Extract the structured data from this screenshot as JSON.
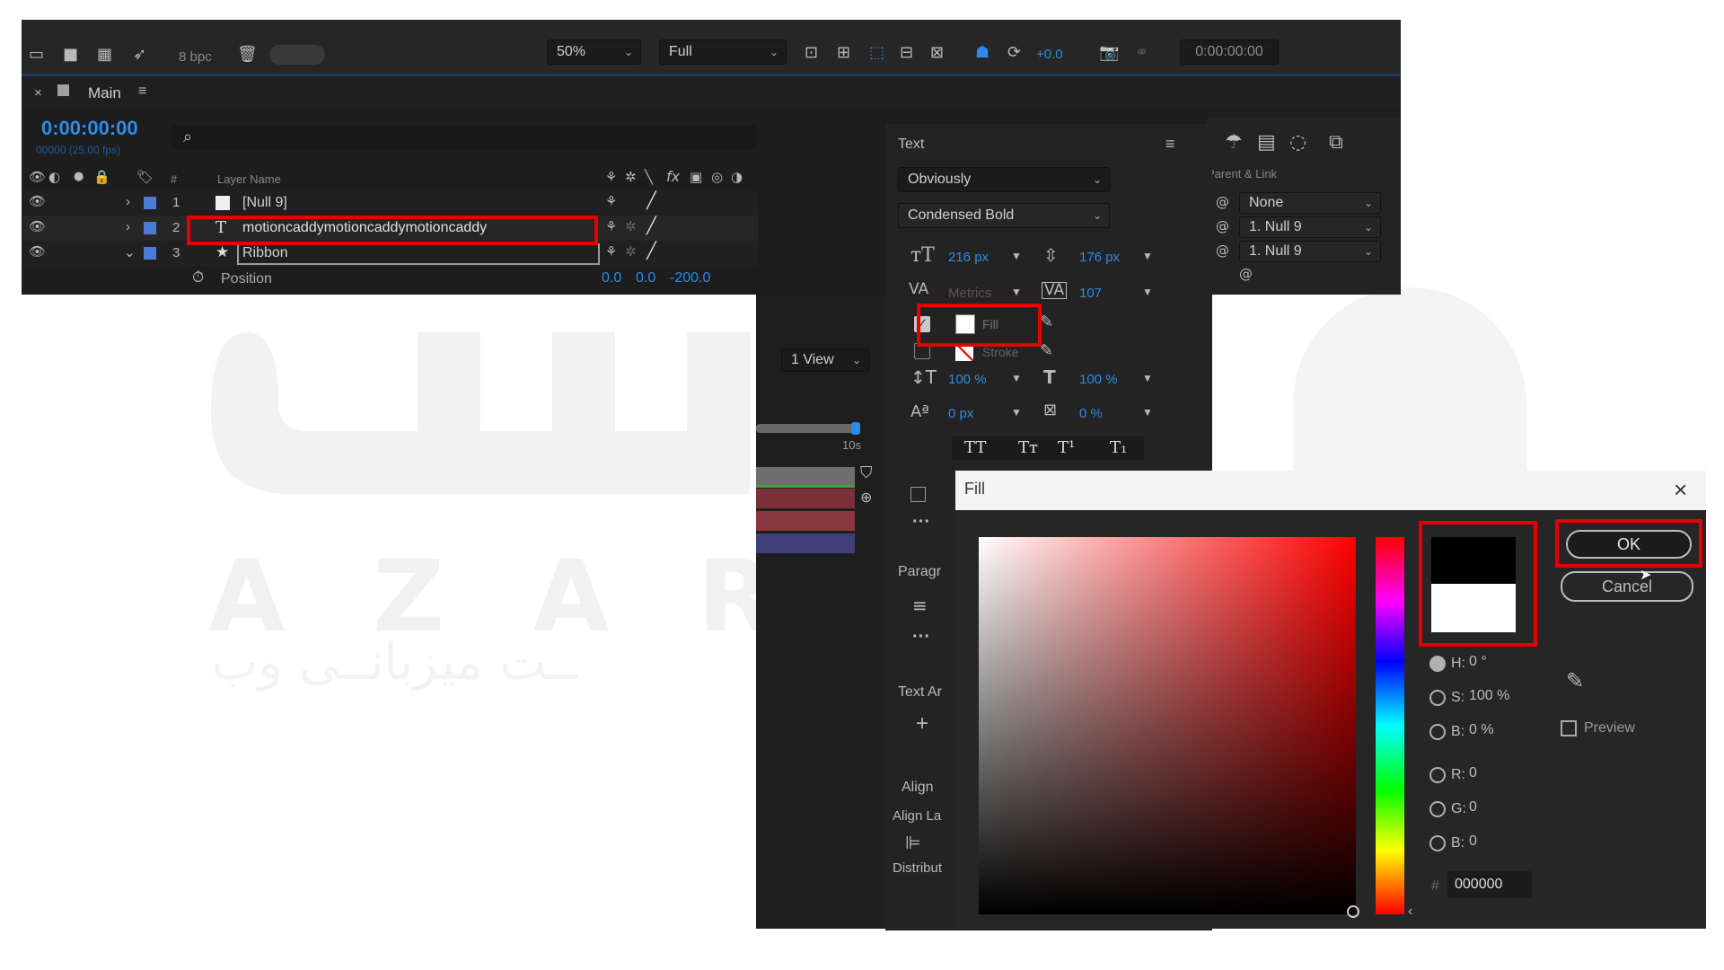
{
  "watermark": {
    "latin": "A   Z   A   R",
    "persian": "ــت میزبانــی وب"
  },
  "toolbar": {
    "bpc": "8 bpc",
    "zoom": "50%",
    "resolution": "Full",
    "exposure": "+0.0",
    "timecode": "0:00:00:00"
  },
  "comp_panel": {
    "tab": "Main",
    "timecode": "0:00:00:00",
    "frame_info": "00000 (25.00 fps)",
    "col_hash": "#",
    "col_layer_name": "Layer Name",
    "col_parent": "Parent & Link"
  },
  "layers": [
    {
      "num": "1",
      "name": "[Null 9]",
      "parent": "None"
    },
    {
      "num": "2",
      "name": "motioncaddymotioncaddymotioncaddy",
      "parent": "1. Null 9"
    },
    {
      "num": "3",
      "name": "Ribbon",
      "parent": "1. Null 9"
    }
  ],
  "position_row": {
    "label": "Position",
    "v1": "0.0",
    "v2": "0.0",
    "v3": "-200.0"
  },
  "viewer": {
    "view_layout": "1 View",
    "ruler_label": "10s"
  },
  "text_panel": {
    "title": "Text",
    "font": "Obviously",
    "style": "Condensed Bold",
    "size": "216 px",
    "leading": "176 px",
    "kerning": "Metrics",
    "tracking": "107",
    "fill_label": "Fill",
    "stroke_label": "Stroke",
    "vscale": "100 %",
    "hscale": "100 %",
    "baseline": "0 px",
    "tsume": "0 %",
    "paragraph": "Paragr",
    "text_anim": "Text Ar",
    "align": "Align",
    "align_layer": "Align La",
    "distribute": "Distribut",
    "caps": [
      "TT",
      "Tт",
      "T¹",
      "T₁"
    ]
  },
  "fill_dialog": {
    "title": "Fill",
    "ok": "OK",
    "cancel": "Cancel",
    "preview": "Preview",
    "h": "0 °",
    "s": "100 %",
    "b": "0 %",
    "r": "0",
    "g": "0",
    "b2": "0",
    "hex": "000000",
    "new_color": "#000000",
    "old_color": "#ffffff"
  },
  "colors": {
    "accent_blue": "#2d8ceb",
    "highlight_red": "#e60000",
    "panel_bg": "#232323"
  }
}
